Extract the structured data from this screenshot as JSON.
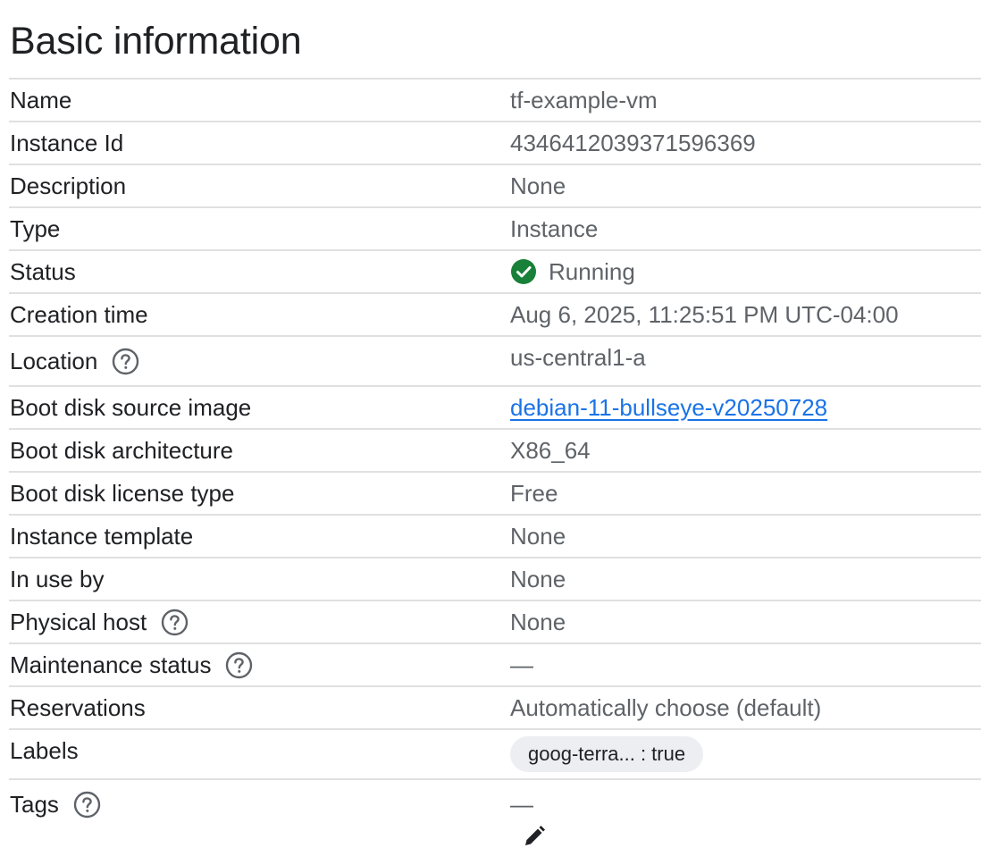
{
  "section": {
    "title": "Basic information"
  },
  "rows": [
    {
      "label": "Name",
      "value": "tf-example-vm"
    },
    {
      "label": "Instance Id",
      "value": "4346412039371596369"
    },
    {
      "label": "Description",
      "value": "None"
    },
    {
      "label": "Type",
      "value": "Instance"
    },
    {
      "label": "Status",
      "value": "Running",
      "status_color": "#188038"
    },
    {
      "label": "Creation time",
      "value": "Aug 6, 2025, 11:25:51 PM UTC-04:00"
    },
    {
      "label": "Location",
      "value": "us-central1-a",
      "help": true
    },
    {
      "label": "Boot disk source image",
      "value": "debian-11-bullseye-v20250728",
      "link_color": "#1a73e8"
    },
    {
      "label": "Boot disk architecture",
      "value": "X86_64"
    },
    {
      "label": "Boot disk license type",
      "value": "Free"
    },
    {
      "label": "Instance template",
      "value": "None"
    },
    {
      "label": "In use by",
      "value": "None"
    },
    {
      "label": "Physical host",
      "value": "None",
      "help": true
    },
    {
      "label": "Maintenance status",
      "value": "—",
      "help": true
    },
    {
      "label": "Reservations",
      "value": "Automatically choose (default)"
    },
    {
      "label": "Labels",
      "value": "goog-terra... : true"
    },
    {
      "label": "Tags",
      "value": "—",
      "help": true
    }
  ],
  "icons": {
    "help": "help-circle-icon",
    "status": "check-circle-icon",
    "edit": "pencil-icon"
  }
}
